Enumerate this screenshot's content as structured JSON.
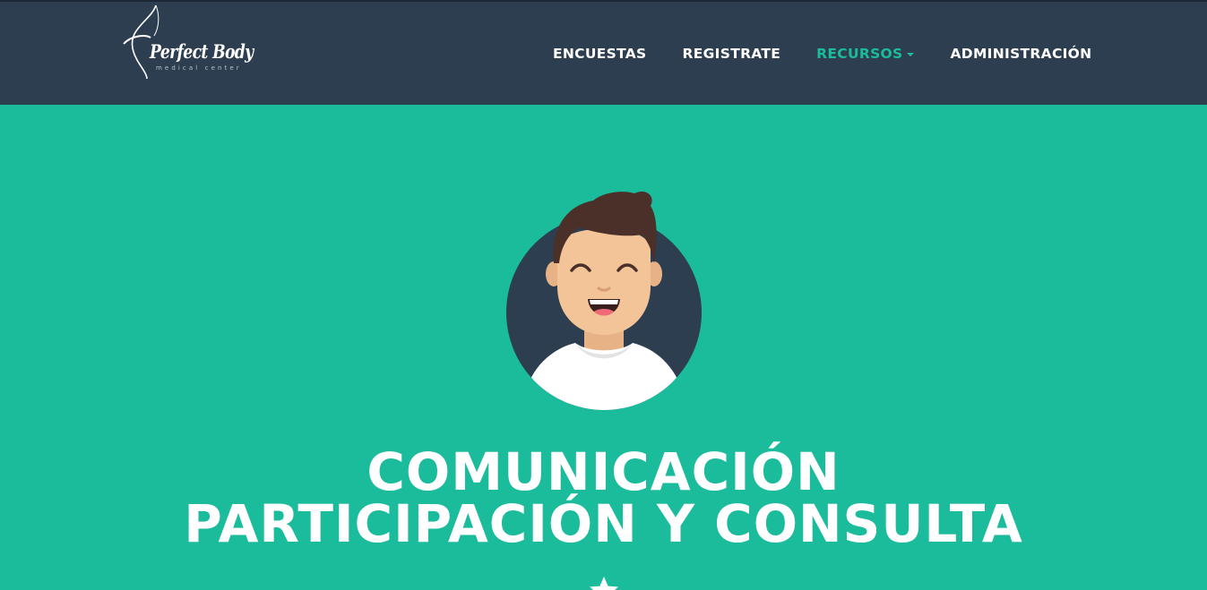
{
  "brand": {
    "name": "Perfect Body",
    "tagline": "medical center",
    "logo_icon": "swoosh-logo-icon"
  },
  "nav": {
    "items": [
      {
        "label": "ENCUESTAS",
        "active": false,
        "dropdown": false
      },
      {
        "label": "REGISTRATE",
        "active": false,
        "dropdown": false
      },
      {
        "label": "RECURSOS",
        "active": true,
        "dropdown": true
      },
      {
        "label": "ADMINISTRACIÓN",
        "active": false,
        "dropdown": false
      }
    ]
  },
  "masthead": {
    "avatar_icon": "smiling-man-avatar-icon",
    "heading_line1": "COMUNICACIÓN",
    "heading_line2": "PARTICIPACIÓN Y CONSULTA",
    "divider_icon": "star-icon"
  },
  "colors": {
    "navbar_bg": "#2c3e50",
    "primary": "#1abc9c",
    "text": "#ffffff",
    "avatar_circle": "#2c3e50",
    "skin": "#f2c497",
    "hair": "#4b2f29"
  }
}
